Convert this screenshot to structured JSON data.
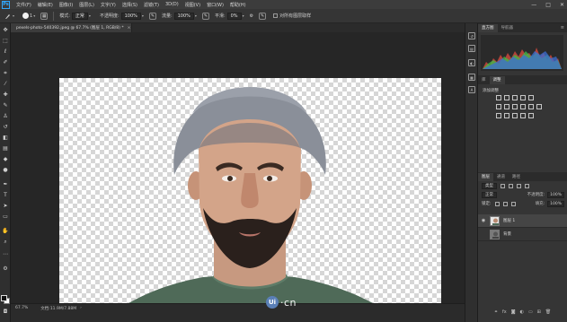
{
  "menubar": {
    "app_logo": "Ps",
    "items": [
      "文件(F)",
      "编辑(E)",
      "图像(I)",
      "图层(L)",
      "文字(Y)",
      "选择(S)",
      "滤镜(T)",
      "3D(D)",
      "视图(V)",
      "窗口(W)",
      "帮助(H)"
    ],
    "window_controls": [
      "—",
      "□",
      "✕"
    ]
  },
  "options": {
    "brush_size": "1",
    "mode_label": "模式:",
    "mode_value": "正常",
    "opacity_label": "不透明度:",
    "opacity_value": "100%",
    "flow_label": "流量:",
    "flow_value": "100%",
    "smoothing_label": "平滑:",
    "smoothing_value": "0%",
    "all_layers_label": "对所有图层取样",
    "gear": "⚙"
  },
  "document": {
    "tab_title": "pexels-photo-540392.jpeg @ 67.7% (图层 1, RGB/8) *",
    "close": "×"
  },
  "status": {
    "zoom": "67.7%",
    "doc_size": "文档:11.9M/7.88M",
    "arrow": "›"
  },
  "watermark": {
    "logo_text": "Ui",
    "text": "·cn"
  },
  "panels": {
    "histogram_tabs": [
      "直方图",
      "导航器"
    ],
    "adjust_tabs": [
      "库",
      "调整"
    ],
    "adjust_title": "添加调整",
    "layers_tabs": [
      "图层",
      "通道",
      "路径"
    ],
    "kind_label": "类型",
    "blend_label": "正常",
    "opacity_label": "不透明度:",
    "opacity_value": "100%",
    "lock_label": "锁定:",
    "fill_label": "填充:",
    "fill_value": "100%",
    "layers": [
      {
        "name": "图层 1",
        "selected": true
      },
      {
        "name": "背景",
        "selected": false
      }
    ],
    "menu_glyph": "≡"
  },
  "colors": {
    "accent": "#31a8ff",
    "panel_bg": "#353535",
    "canvas_bg": "#262626",
    "hat": "#8a8f99",
    "shirt": "#4f6e5a"
  },
  "icons": [
    "move-icon",
    "marquee-icon",
    "lasso-icon",
    "quick-select-icon",
    "crop-icon",
    "eyedropper-icon",
    "healing-icon",
    "brush-icon",
    "clone-stamp-icon",
    "history-brush-icon",
    "eraser-icon",
    "gradient-icon",
    "blur-icon",
    "dodge-icon",
    "pen-icon",
    "type-icon",
    "path-select-icon",
    "shape-icon",
    "hand-icon",
    "zoom-icon"
  ]
}
